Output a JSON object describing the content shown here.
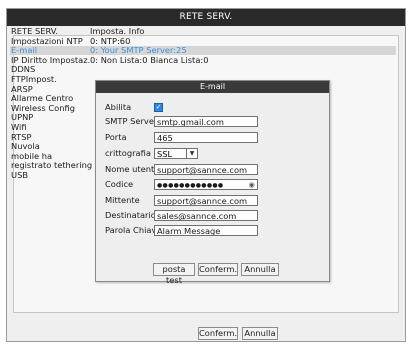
{
  "window": {
    "title": "RETE SERV."
  },
  "sidebar": {
    "items": [
      {
        "label": "RETE SERV."
      },
      {
        "label": "Impostazioni NTP"
      },
      {
        "label": "E-mail"
      },
      {
        "label": "IP Diritto Impostaz."
      },
      {
        "label": "DDNS"
      },
      {
        "label": "FTPImpost."
      },
      {
        "label": "ARSP"
      },
      {
        "label": "Allarme Centro"
      },
      {
        "label": "Wireless Config"
      },
      {
        "label": "UPNP"
      },
      {
        "label": "Wifi"
      },
      {
        "label": "RTSP"
      },
      {
        "label": "Nuvola"
      },
      {
        "label": "mobile ha registrato tethering USB"
      }
    ]
  },
  "info": {
    "header": "Imposta. Info",
    "rows": [
      "0: NTP:60",
      "0: Your SMTP Server:25",
      "0: Non Lista:0 Bianca Lista:0"
    ]
  },
  "dialog": {
    "title": "E-mail",
    "enable_label": "Abilita",
    "enable_checked": true,
    "smtp_label": "SMTP Server",
    "smtp_value": "smtp.gmail.com",
    "port_label": "Porta",
    "port_value": "465",
    "crypt_label": "crittografia",
    "crypt_value": "SSL",
    "user_label": "Nome utente",
    "user_value": "support@sannce.com",
    "code_label": "Codice",
    "code_value": "●●●●●●●●●●●●",
    "sender_label": "Mittente",
    "sender_value": "support@sannce.com",
    "recipient_label": "Destinatario",
    "recipient_value": "sales@sannce.com",
    "keyword_label": "Parola Chiave",
    "keyword_value": "Alarm Message",
    "test_label": "posta test",
    "confirm_label": "Conferm.",
    "cancel_label": "Annulla"
  },
  "footer": {
    "confirm_label": "Conferm.",
    "cancel_label": "Annulla"
  }
}
